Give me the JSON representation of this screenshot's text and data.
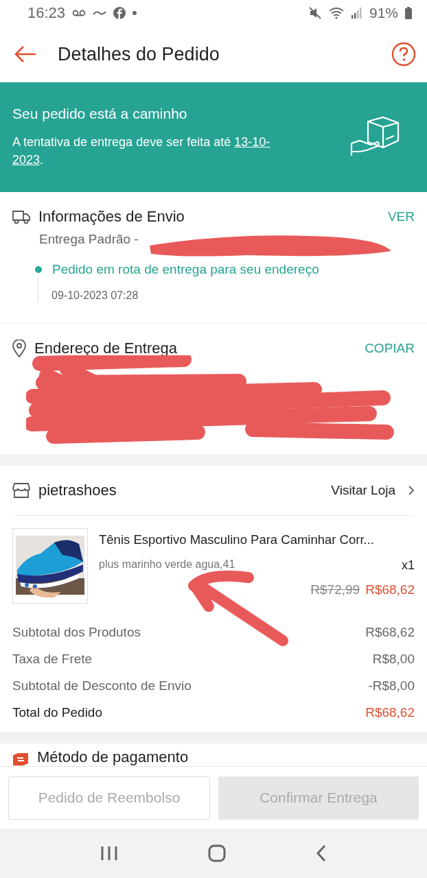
{
  "status_bar": {
    "time": "16:23",
    "battery": "91%"
  },
  "header": {
    "title": "Detalhes do Pedido"
  },
  "banner": {
    "title": "Seu pedido está a caminho",
    "text": "A tentativa de entrega deve ser feita até",
    "date": "13-10-2023",
    "suffix": "."
  },
  "shipping": {
    "title": "Informações de Envio",
    "action": "VER",
    "carrier": "Entrega Padrão -",
    "event": "Pedido em rota de entrega para seu endereço",
    "event_time": "09-10-2023 07:28"
  },
  "address": {
    "title": "Endereço de Entrega",
    "action": "COPIAR"
  },
  "shop": {
    "name": "pietrashoes",
    "link": "Visitar Loja"
  },
  "product": {
    "name": "Tênis Esportivo Masculino Para Caminhar Corr...",
    "variant": "plus marinho verde agua,41",
    "quantity": "x1",
    "original_price": "R$72,99",
    "price": "R$68,62"
  },
  "summary": [
    {
      "label": "Subtotal dos Produtos",
      "value": "R$68,62",
      "kind": "normal"
    },
    {
      "label": "Taxa de Frete",
      "value": "R$8,00",
      "kind": "normal"
    },
    {
      "label": "Subtotal de Desconto de Envio",
      "value": "-R$8,00",
      "kind": "normal"
    },
    {
      "label": "Total do Pedido",
      "value": "R$68,62",
      "kind": "total"
    }
  ],
  "payment": {
    "title": "Método de pagamento"
  },
  "buttons": [
    {
      "label": "Pedido de Reembolso",
      "kind": "outline",
      "disabled": true
    },
    {
      "label": "Confirmar Entrega",
      "kind": "filled",
      "disabled": true
    }
  ]
}
